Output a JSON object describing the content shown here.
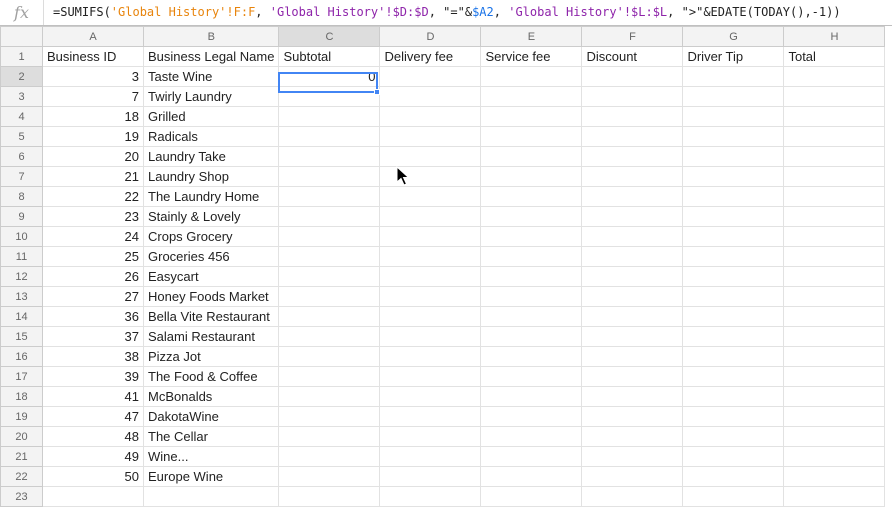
{
  "formula_bar": {
    "icon": "fx",
    "segments": [
      {
        "text": "=SUMIFS(",
        "color": "#222222"
      },
      {
        "text": "'Global History'!F:F",
        "color": "#e8840c"
      },
      {
        "text": ", ",
        "color": "#222222"
      },
      {
        "text": "'Global History'!$D:$D",
        "color": "#8e24aa"
      },
      {
        "text": ", ",
        "color": "#222222"
      },
      {
        "text": "\"=\"",
        "color": "#222222"
      },
      {
        "text": "&",
        "color": "#222222"
      },
      {
        "text": "$A2",
        "color": "#1a73e8"
      },
      {
        "text": ", ",
        "color": "#222222"
      },
      {
        "text": "'Global History'!$L:$L",
        "color": "#8e24aa"
      },
      {
        "text": ", ",
        "color": "#222222"
      },
      {
        "text": "\">\"",
        "color": "#222222"
      },
      {
        "text": "&EDATE(TODAY(),-1))",
        "color": "#222222"
      }
    ]
  },
  "columns": [
    "A",
    "B",
    "C",
    "D",
    "E",
    "F",
    "G",
    "H"
  ],
  "headers": [
    "Business ID",
    "Business Legal Name",
    "Subtotal",
    "Delivery fee",
    "Service fee",
    "Discount",
    "Driver Tip",
    "Total"
  ],
  "rows": [
    {
      "id": "3",
      "name": "Taste Wine",
      "subtotal": "0"
    },
    {
      "id": "7",
      "name": "Twirly Laundry",
      "subtotal": ""
    },
    {
      "id": "18",
      "name": "Grilled",
      "subtotal": ""
    },
    {
      "id": "19",
      "name": "Radicals",
      "subtotal": ""
    },
    {
      "id": "20",
      "name": "Laundry Take",
      "subtotal": ""
    },
    {
      "id": "21",
      "name": "Laundry Shop",
      "subtotal": ""
    },
    {
      "id": "22",
      "name": "The Laundry Home",
      "subtotal": ""
    },
    {
      "id": "23",
      "name": "Stainly & Lovely",
      "subtotal": ""
    },
    {
      "id": "24",
      "name": "Crops Grocery",
      "subtotal": ""
    },
    {
      "id": "25",
      "name": "Groceries 456",
      "subtotal": ""
    },
    {
      "id": "26",
      "name": "Easycart",
      "subtotal": ""
    },
    {
      "id": "27",
      "name": "Honey Foods Market",
      "subtotal": ""
    },
    {
      "id": "36",
      "name": "Bella Vite Restaurant",
      "subtotal": ""
    },
    {
      "id": "37",
      "name": "Salami Restaurant",
      "subtotal": ""
    },
    {
      "id": "38",
      "name": "Pizza Jot",
      "subtotal": ""
    },
    {
      "id": "39",
      "name": "The Food & Coffee",
      "subtotal": ""
    },
    {
      "id": "41",
      "name": "McBonalds",
      "subtotal": ""
    },
    {
      "id": "47",
      "name": "DakotaWine",
      "subtotal": ""
    },
    {
      "id": "48",
      "name": "The Cellar",
      "subtotal": ""
    },
    {
      "id": "49",
      "name": "Wine...",
      "subtotal": ""
    },
    {
      "id": "50",
      "name": "Europe Wine",
      "subtotal": ""
    }
  ],
  "row_numbers": [
    "1",
    "2",
    "3",
    "4",
    "5",
    "6",
    "7",
    "8",
    "9",
    "10",
    "11",
    "12",
    "13",
    "14",
    "15",
    "16",
    "17",
    "18",
    "19",
    "20",
    "21",
    "22",
    "23"
  ],
  "selection": {
    "cell": "C2",
    "color": "#4285f4"
  },
  "icons": {
    "cursor": "mouse-pointer-icon"
  }
}
